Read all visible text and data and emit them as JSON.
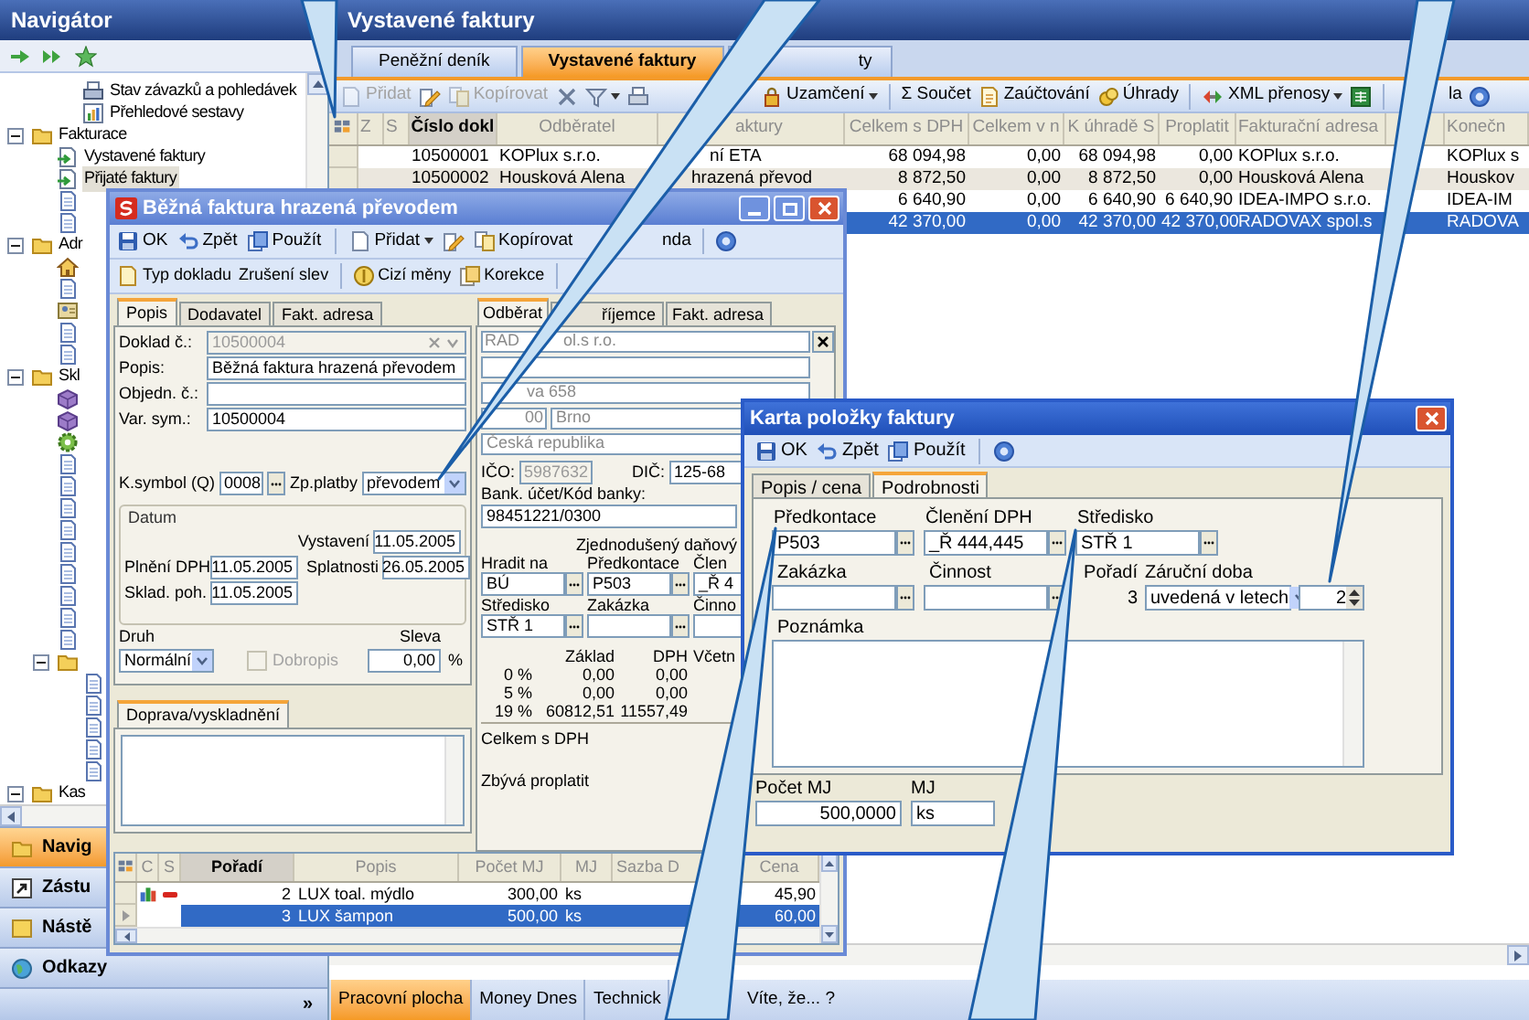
{
  "navigator": {
    "title": "Navigátor",
    "tree": [
      {
        "children": [
          {
            "children": [
              {
                "label": "Stav závazků a pohledávek",
                "kind": "report",
                "selected": false
              },
              {
                "label": "Přehledové sestavy",
                "kind": "chart",
                "selected": false
              }
            ]
          }
        ]
      },
      {
        "label": "Fakturace",
        "kind": "folder",
        "expanded": true,
        "selected": false,
        "children": [
          {
            "label": "Vystavené faktury",
            "kind": "invoice",
            "selected": false
          },
          {
            "label": "Přijaté faktury",
            "kind": "invoice",
            "selected": true
          },
          {
            "kind": "doc",
            "selected": false
          },
          {
            "kind": "doc",
            "selected": false
          }
        ]
      },
      {
        "label": "Adr",
        "kind": "folder",
        "expanded": true,
        "selected": false,
        "children": [
          {
            "kind": "home",
            "selected": false
          },
          {
            "kind": "doc",
            "selected": false
          },
          {
            "kind": "card",
            "selected": false
          },
          {
            "kind": "doc",
            "selected": false
          },
          {
            "kind": "doc",
            "selected": false
          }
        ]
      },
      {
        "label": "Skl",
        "kind": "folder",
        "expanded": true,
        "selected": false,
        "children": [
          {
            "kind": "box",
            "selected": false
          },
          {
            "kind": "box",
            "selected": false
          },
          {
            "kind": "gear",
            "selected": false
          },
          {
            "kind": "doc",
            "selected": false
          },
          {
            "kind": "doc",
            "selected": false
          },
          {
            "kind": "doc",
            "selected": false
          },
          {
            "kind": "doc",
            "selected": false
          },
          {
            "kind": "doc",
            "selected": false
          },
          {
            "kind": "doc",
            "selected": false
          },
          {
            "kind": "doc",
            "selected": false
          },
          {
            "kind": "doc",
            "selected": false
          },
          {
            "kind": "doc",
            "selected": false
          },
          {
            "kind": "folder",
            "expanded": true,
            "selected": false,
            "children": [
              {
                "kind": "doc",
                "selected": false
              },
              {
                "kind": "doc",
                "selected": false
              },
              {
                "kind": "doc",
                "selected": false
              },
              {
                "kind": "doc",
                "selected": false
              },
              {
                "kind": "doc",
                "selected": false
              }
            ]
          }
        ]
      },
      {
        "label": "Kas",
        "kind": "folder",
        "expanded": true,
        "selected": false
      }
    ],
    "sections": [
      {
        "label": "Navig",
        "kind": "folder",
        "selected": true
      },
      {
        "label": "Zástu",
        "kind": "shortcut",
        "selected": false
      },
      {
        "label": "Nástě",
        "kind": "note",
        "selected": false
      },
      {
        "label": "Odkazy",
        "kind": "globe",
        "selected": false
      }
    ],
    "more": "»"
  },
  "main": {
    "title": "Vystavené faktury",
    "tabs": [
      {
        "label": "Peněžní deník",
        "selected": false
      },
      {
        "label": "Vystavené faktury",
        "selected": true
      },
      {
        "label": "ty",
        "selected": false
      }
    ],
    "toolbar": [
      {
        "label": "Přidat",
        "kind": "new",
        "disabled": true,
        "dropdown": false
      },
      {
        "kind": "edit",
        "disabled": false,
        "dropdown": false
      },
      {
        "label": "Kopírovat",
        "kind": "copy",
        "disabled": true,
        "dropdown": false
      },
      {
        "kind": "delete",
        "disabled": false,
        "dropdown": false
      },
      {
        "kind": "filter",
        "disabled": false,
        "dropdown": true
      },
      {
        "kind": "print",
        "disabled": false,
        "dropdown": false
      }
    ],
    "toolbar_right": [
      {
        "label": "Uzamčení",
        "kind": "lock",
        "disabled": false,
        "dropdown": true
      },
      {
        "kind": "separator"
      },
      {
        "label": "Součet",
        "symbol": "Σ",
        "disabled": false,
        "dropdown": false
      },
      {
        "label": "Zaúčtování",
        "kind": "journal",
        "disabled": false,
        "dropdown": false
      },
      {
        "label": "Úhrady",
        "kind": "coins",
        "disabled": false,
        "dropdown": false
      },
      {
        "kind": "separator"
      },
      {
        "label": "XML přenosy",
        "kind": "xml",
        "disabled": false,
        "dropdown": true
      },
      {
        "kind": "excel",
        "disabled": false,
        "dropdown": false
      },
      {
        "kind": "separator"
      }
    ],
    "toolbar_tail": [
      {
        "label": "la",
        "disabled": false,
        "dropdown": false
      },
      {
        "kind": "help",
        "disabled": false,
        "dropdown": false
      }
    ],
    "table": {
      "columns": [
        {
          "label": "Z",
          "sorted": false,
          "kind": "text"
        },
        {
          "label": "S",
          "sorted": false,
          "kind": "text"
        },
        {
          "label": "Číslo dokl",
          "sorted": true,
          "kind": "text"
        },
        {
          "label": "Odběratel",
          "sorted": false,
          "kind": "text"
        },
        {
          "label": "aktury",
          "sorted": false,
          "kind": "text"
        },
        {
          "label": "Celkem s DPH",
          "sorted": false,
          "kind": "number"
        },
        {
          "label": "Celkem v n",
          "sorted": false,
          "kind": "number"
        },
        {
          "label": "K úhradě S",
          "sorted": false,
          "kind": "number"
        },
        {
          "label": "Proplatit",
          "sorted": false,
          "kind": "number"
        },
        {
          "label": "Fakturační adresa",
          "sorted": false,
          "kind": "text"
        },
        {
          "sorted": false,
          "kind": "text"
        },
        {
          "label": "Konečn",
          "sorted": false,
          "kind": "text"
        }
      ],
      "rows": [
        {
          "selected": false,
          "cells": [
            "",
            "",
            "10500001",
            "KOPlux s.r.o.",
            "ní ETA",
            "68 094,98",
            "0,00",
            "68 094,98",
            "0,00",
            "KOPlux s.r.o.",
            "",
            "KOPlux s"
          ]
        },
        {
          "selected": false,
          "cells": [
            "",
            "",
            "10500002",
            "Housková Alena",
            "hrazená převod",
            "8 872,50",
            "0,00",
            "8 872,50",
            "0,00",
            "Housková Alena",
            "",
            "Houskov"
          ]
        },
        {
          "selected": false,
          "cells": [
            "",
            "",
            "",
            "",
            "",
            "6 640,90",
            "0,00",
            "6 640,90",
            "6 640,90",
            "IDEA-IMPO s.r.o.",
            "",
            "IDEA-IM"
          ]
        },
        {
          "selected": true,
          "cells": [
            "",
            "",
            "",
            "",
            "",
            "42 370,00",
            "0,00",
            "42 370,00",
            "42 370,00",
            "RADOVAX spol.s",
            "",
            "RADOVA"
          ]
        }
      ]
    },
    "bottom_tabs": [
      {
        "label": "Pracovní plocha",
        "selected": true
      },
      {
        "label": "Money Dnes",
        "selected": false
      },
      {
        "label": "Technick",
        "selected": false
      },
      {
        "label": "Víte, že... ?",
        "selected": false
      }
    ]
  },
  "invoice_dialog": {
    "title": "Běžná faktura hrazená převodem",
    "toolbar": [
      {
        "label": "OK",
        "kind": "save",
        "dropdown": false
      },
      {
        "label": "Zpět",
        "kind": "undo",
        "dropdown": false
      },
      {
        "label": "Použít",
        "kind": "apply",
        "dropdown": false
      },
      {
        "kind": "separator"
      },
      {
        "label": "Přidat",
        "kind": "new",
        "dropdown": true
      },
      {
        "kind": "edit",
        "dropdown": false
      },
      {
        "label": "Kopírovat",
        "kind": "copy",
        "dropdown": false
      }
    ],
    "toolbar_right": [
      {
        "label": "nda",
        "dropdown": false
      },
      {
        "kind": "separator"
      },
      {
        "kind": "help",
        "dropdown": false
      }
    ],
    "toolbar_2": [
      {
        "label": "Typ dokladu",
        "kind": "doctype",
        "dropdown": false
      },
      {
        "label": "Zrušení slev",
        "dropdown": false
      },
      {
        "kind": "separator"
      },
      {
        "label": "Cizí měny",
        "kind": "currency",
        "dropdown": false
      },
      {
        "label": "Korekce",
        "kind": "correction",
        "dropdown": false
      },
      {
        "kind": "separator"
      }
    ],
    "left_tabs": [
      {
        "label": "Popis",
        "selected": true
      },
      {
        "label": "Dodavatel",
        "selected": false
      },
      {
        "label": "Fakt. adresa",
        "selected": false
      }
    ],
    "fields": [
      {
        "label": "Doklad č.:",
        "value": "10500004",
        "disabled": true
      },
      {
        "label": "Popis:",
        "value": "Běžná faktura hrazená převodem",
        "disabled": false
      },
      {
        "label": "Objedn. č.:",
        "disabled": false
      },
      {
        "label": "Var. sym.:",
        "value": "10500004",
        "disabled": false
      }
    ],
    "k_symbol": {
      "label": "K.symbol (Q)",
      "value": "0008"
    },
    "payment": {
      "label": "Zp.platby",
      "value": "převodem"
    },
    "dates": {
      "title": "Datum",
      "issued": {
        "label": "Vystavení",
        "value": "11.05.2005"
      },
      "vat_date": {
        "label": "Plnění DPH",
        "value": "11.05.2005"
      },
      "due": {
        "label": "Splatnosti",
        "value": "26.05.2005"
      },
      "stock": {
        "label": "Sklad. poh.",
        "value": "11.05.2005"
      }
    },
    "kind_field": {
      "label": "Druh",
      "value": "Normální"
    },
    "credit_note": {
      "label": "Dobropis",
      "checked": false,
      "disabled": true
    },
    "discount": {
      "label": "Sleva",
      "value": "0,00",
      "unit": "%"
    },
    "transport_tab": "Doprava/vyskladnění",
    "right_tabs": [
      {
        "label": "Odběrat",
        "selected": true
      },
      {
        "label": "říjemce",
        "selected": false
      },
      {
        "label": "Fakt. adresa",
        "selected": false
      }
    ],
    "address": {
      "disabled": true,
      "name_parts": [
        "RAD",
        "ol.s r.o."
      ],
      "street": "va 658",
      "zip": "00",
      "city": "Brno",
      "country": "Česká republika"
    },
    "ico": {
      "label": "IČO:",
      "value": "5987632",
      "disabled": true
    },
    "dic": {
      "label": "DIČ:",
      "value": "125-68"
    },
    "bank": {
      "label": "Bank. účet/Kód banky:",
      "value": "98451221/0300"
    },
    "simplified": "Zjednodušený daňový",
    "pay_fields": [
      {
        "label": "Hradit na",
        "value": "BÚ"
      },
      {
        "label": "Předkontace",
        "value": "P503"
      },
      {
        "label": "Člen",
        "value": "_Ř 4"
      },
      {
        "label": "Středisko",
        "value": "STŘ 1"
      },
      {
        "label": "Zakázka"
      },
      {
        "label": "Činno"
      }
    ],
    "vat_header": [
      "Základ",
      "DPH",
      "Včetn"
    ],
    "vat_rows": [
      [
        "0 %",
        "0,00",
        "0,00"
      ],
      [
        "5 %",
        "0,00",
        "0,00"
      ],
      [
        "19 %",
        "60812,51",
        "11557,49"
      ]
    ],
    "totals": [
      "Celkem s DPH",
      "Zbývá proplatit"
    ],
    "items": {
      "columns": [
        "C",
        "S",
        "Pořadí",
        "Popis",
        "Počet MJ",
        "MJ",
        "Sazba D",
        "Cena"
      ],
      "rows": [
        {
          "selected": false,
          "flags": true,
          "cells": [
            "",
            "",
            "2",
            "LUX toal. mýdlo",
            "300,00",
            "ks",
            "",
            "45,90"
          ]
        },
        {
          "selected": true,
          "flags": false,
          "cells": [
            "",
            "",
            "3",
            "LUX šampon",
            "500,00",
            "ks",
            "",
            "60,00"
          ]
        }
      ]
    }
  },
  "item_dialog": {
    "title": "Karta položky faktury",
    "toolbar": [
      {
        "label": "OK",
        "kind": "save",
        "dropdown": false
      },
      {
        "label": "Zpět",
        "kind": "undo",
        "dropdown": false
      },
      {
        "label": "Použít",
        "kind": "apply",
        "dropdown": false
      },
      {
        "kind": "separator"
      },
      {
        "kind": "help",
        "dropdown": false
      }
    ],
    "tabs": [
      {
        "label": "Popis / cena",
        "selected": false
      },
      {
        "label": "Podrobnosti",
        "selected": true
      }
    ],
    "fields_row_1": [
      {
        "label": "Předkontace",
        "value": "P503"
      },
      {
        "label": "Členění DPH",
        "value": "_Ř 444,445"
      },
      {
        "label": "Středisko",
        "value": "STŘ 1"
      }
    ],
    "fields_row_2": [
      {
        "label": "Zakázka"
      },
      {
        "label": "Činnost"
      }
    ],
    "order": {
      "label": "Pořadí",
      "value": "3"
    },
    "warranty": {
      "label": "Záruční doba",
      "value": "uvedená v letech",
      "count": "2"
    },
    "note": {
      "label": "Poznámka"
    },
    "quantity": {
      "label": "Počet MJ",
      "value": "500,0000"
    },
    "unit": {
      "label": "MJ",
      "value": "ks"
    }
  }
}
